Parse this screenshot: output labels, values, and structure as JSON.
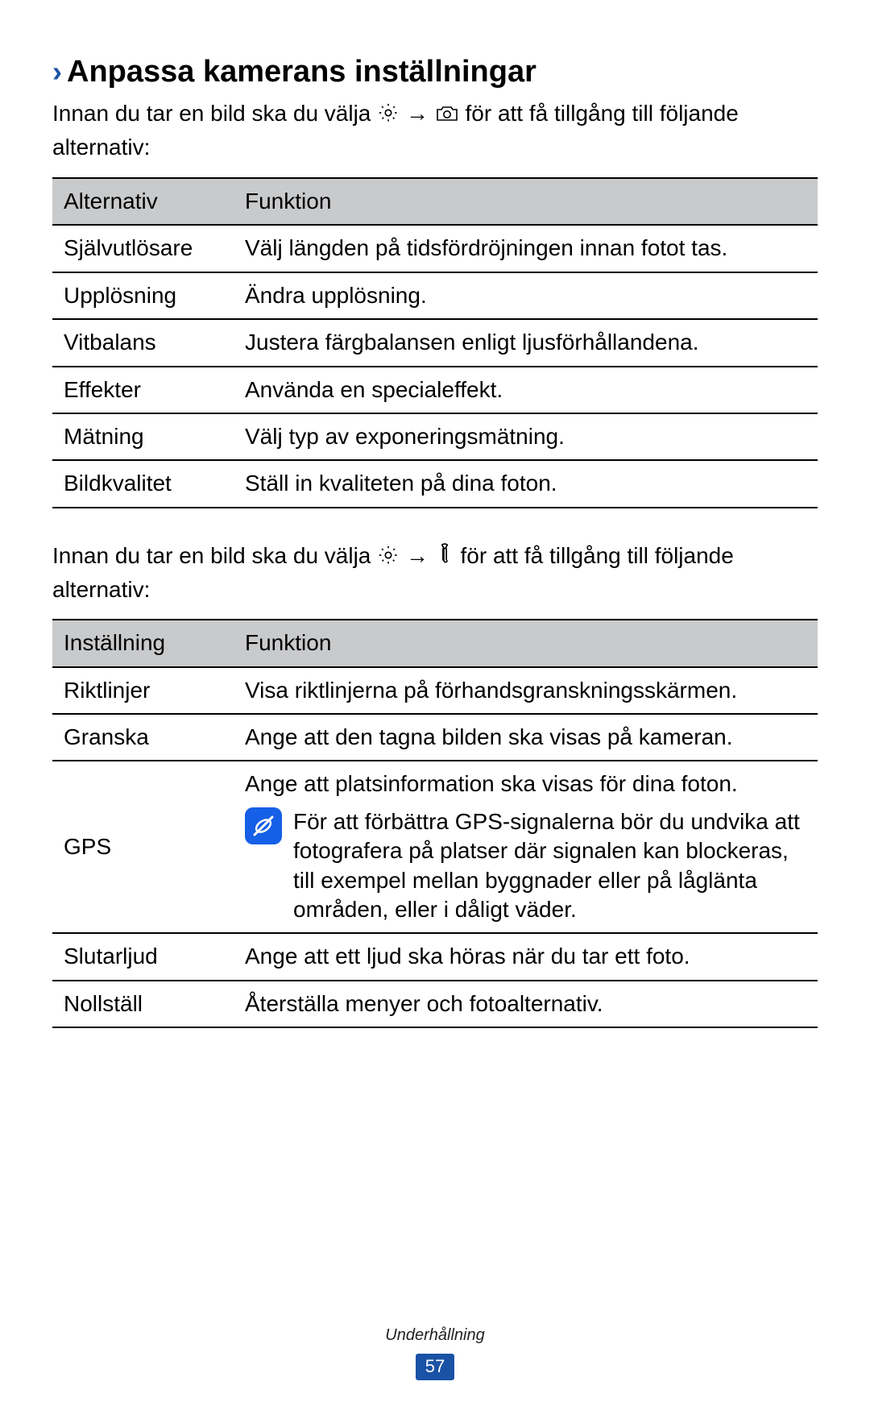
{
  "heading": "Anpassa kamerans inställningar",
  "intro1_a": "Innan du tar en bild ska du välja ",
  "intro1_b": " → ",
  "intro1_c": " för att få tillgång till följande alternativ:",
  "table1": {
    "head_a": "Alternativ",
    "head_b": "Funktion",
    "rows": [
      {
        "opt": "Självutlösare",
        "fn": "Välj längden på tidsfördröjningen innan fotot tas."
      },
      {
        "opt": "Upplösning",
        "fn": "Ändra upplösning."
      },
      {
        "opt": "Vitbalans",
        "fn": "Justera färgbalansen enligt ljusförhållandena."
      },
      {
        "opt": "Effekter",
        "fn": "Använda en specialeffekt."
      },
      {
        "opt": "Mätning",
        "fn": "Välj typ av exponeringsmätning."
      },
      {
        "opt": "Bildkvalitet",
        "fn": "Ställ in kvaliteten på dina foton."
      }
    ]
  },
  "intro2_a": "Innan du tar en bild ska du välja ",
  "intro2_b": " → ",
  "intro2_c": " för att få tillgång till följande alternativ:",
  "table2": {
    "head_a": "Inställning",
    "head_b": "Funktion",
    "rows": [
      {
        "opt": "Riktlinjer",
        "fn": "Visa riktlinjerna på förhandsgranskningsskärmen."
      },
      {
        "opt": "Granska",
        "fn": "Ange att den tagna bilden ska visas på kameran."
      },
      {
        "opt": "GPS",
        "fn": "Ange att platsinformation ska visas för dina foton.",
        "note": "För att förbättra GPS-signalerna bör du undvika att fotografera på platser där signalen kan blockeras, till exempel mellan byggnader eller på låglänta områden, eller i dåligt väder."
      },
      {
        "opt": "Slutarljud",
        "fn": "Ange att ett ljud ska höras när du tar ett foto."
      },
      {
        "opt": "Nollställ",
        "fn": "Återställa menyer och fotoalternativ."
      }
    ]
  },
  "footer_label": "Underhållning",
  "page_number": "57"
}
